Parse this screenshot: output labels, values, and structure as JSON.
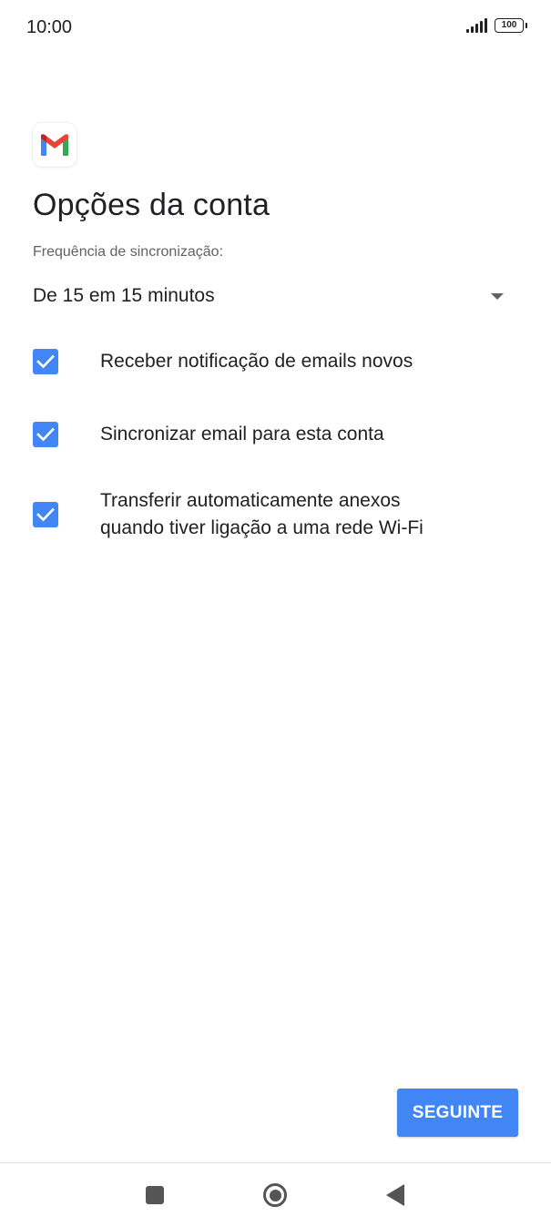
{
  "status_bar": {
    "time": "10:00",
    "battery_level": "100",
    "icons": [
      "signal-icon",
      "battery-icon"
    ]
  },
  "app": {
    "logo_icon": "gmail-icon"
  },
  "page": {
    "title": "Opções da conta"
  },
  "sync": {
    "label": "Frequência de sincronização:",
    "value": "De 15 em 15 minutos",
    "dropdown_icon": "dropdown-arrow-icon"
  },
  "options": [
    {
      "label": "Receber notificação de emails novos",
      "checked": true
    },
    {
      "label": "Sincronizar email para esta conta",
      "checked": true
    },
    {
      "label_line1": "Transferir automaticamente anexos",
      "label_line2": "quando tiver ligação a uma rede Wi-Fi",
      "checked": true
    }
  ],
  "actions": {
    "next_label": "SEGUINTE"
  },
  "nav_bar": {
    "icons": [
      "recents-square-icon",
      "home-circle-icon",
      "back-triangle-icon"
    ]
  },
  "colors": {
    "accent": "#4285f4",
    "text_primary": "#202124",
    "text_secondary": "#5f6368",
    "nav_icon": "#555555"
  }
}
